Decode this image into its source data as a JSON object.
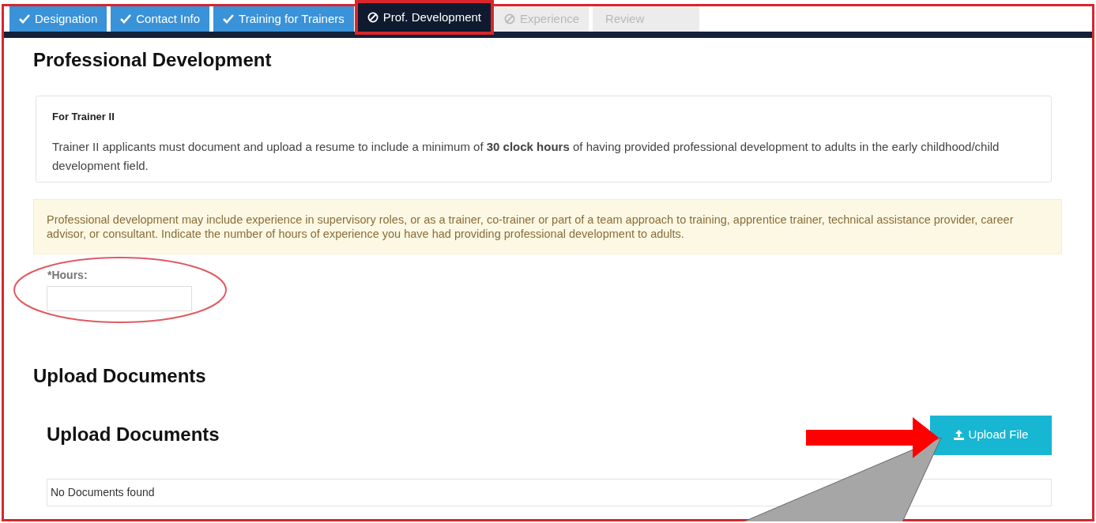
{
  "tabs": [
    {
      "label": "Designation",
      "kind": "done",
      "selected": false
    },
    {
      "label": "Contact Info",
      "kind": "done",
      "selected": false
    },
    {
      "label": "Training for Trainers",
      "kind": "done",
      "selected": false
    },
    {
      "label": "Prof. Development",
      "kind": "blocked",
      "selected": true
    },
    {
      "label": "Experience",
      "kind": "blocked",
      "selected": false
    },
    {
      "label": "Review",
      "kind": "pending",
      "selected": false
    }
  ],
  "page_title": "Professional Development",
  "info_card": {
    "title": "For Trainer II",
    "text": "Trainer II applicants must document and upload a resume to include a minimum of **30 clock hours** of having provided professional development to adults in the early childhood/child development field."
  },
  "notice": "Professional development may include experience in supervisory roles, or as a trainer, co-trainer or part of a team approach to training, apprentice trainer, technical assistance provider, career advisor, or consultant. Indicate the number of hours of experience you have had providing professional development to adults.",
  "hours_field": {
    "label": "*Hours:"
  },
  "upload_section": {
    "title": "Upload Documents",
    "panel_title": "Upload Documents",
    "button": "Upload File",
    "empty_message": "No Documents found"
  }
}
